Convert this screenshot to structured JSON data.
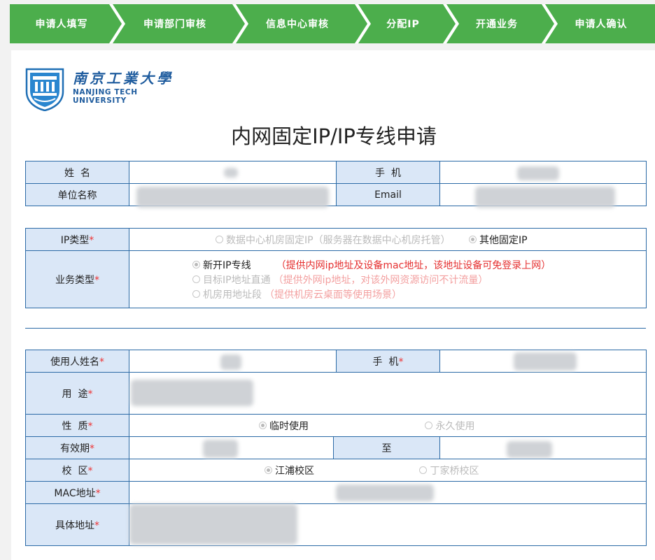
{
  "steps": [
    "申请人填写",
    "申请部门审核",
    "信息中心审核",
    "分配IP",
    "开通业务",
    "申请人确认"
  ],
  "colors": {
    "step_green": "#4cae4c",
    "label_bg": "#dae7f7",
    "border": "#2b6aa6",
    "required": "#e33333"
  },
  "logo": {
    "cn": "南京工業大學",
    "en_line1": "NANJING TECH",
    "en_line2": "UNIVERSITY"
  },
  "title": "内网固定IP/IP专线申请",
  "applicant": {
    "name_label": "姓  名",
    "phone_label": "手  机",
    "unit_label": "单位名称",
    "email_label": "Email"
  },
  "ip_type": {
    "label": "IP类型",
    "options": [
      {
        "text": "数据中心机房固定IP（服务器在数据中心机房托管）",
        "selected": false
      },
      {
        "text": "其他固定IP",
        "selected": true
      }
    ]
  },
  "business": {
    "label": "业务类型",
    "options": [
      {
        "text": "新开IP专线",
        "hint": "（提供内网ip地址及设备mac地址，该地址设备可免登录上网）",
        "selected": true
      },
      {
        "text": "目标IP地址直通",
        "hint": "（提供外网ip地址，对该外网资源访问不计流量）",
        "selected": false
      },
      {
        "text": "机房用地址段",
        "hint": "（提供机房云桌面等使用场景）",
        "selected": false
      }
    ]
  },
  "user": {
    "name_label": "使用人姓名",
    "phone_label": "手  机",
    "purpose_label": "用  途",
    "nature_label": "性  质",
    "nature_options": [
      {
        "text": "临时使用",
        "selected": true
      },
      {
        "text": "永久使用",
        "selected": false
      }
    ],
    "valid_label": "有效期",
    "to_label": "至",
    "campus_label": "校  区",
    "campus_options": [
      {
        "text": "江浦校区",
        "selected": true
      },
      {
        "text": "丁家桥校区",
        "selected": false
      }
    ],
    "mac_label": "MAC地址",
    "address_label": "具体地址",
    "required_mark": "*"
  }
}
